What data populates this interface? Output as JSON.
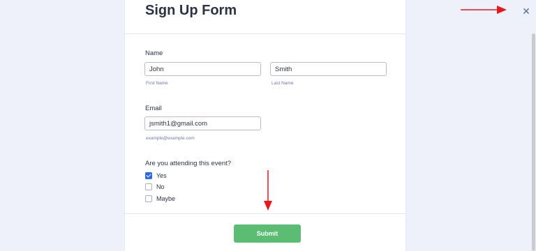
{
  "form": {
    "title": "Sign Up Form",
    "name": {
      "label": "Name",
      "first_value": "John",
      "first_sublabel": "First Name",
      "last_value": "Smith",
      "last_sublabel": "Last Name"
    },
    "email": {
      "label": "Email",
      "value": "jsmith1@gmail.com",
      "sublabel": "example@example.com"
    },
    "attending": {
      "question": "Are you attending this event?",
      "options": [
        {
          "label": "Yes",
          "checked": true
        },
        {
          "label": "No",
          "checked": false
        },
        {
          "label": "Maybe",
          "checked": false
        }
      ]
    },
    "submit_label": "Submit"
  },
  "close_icon": "close-icon",
  "annotation_color": "#e8171c",
  "colors": {
    "accent": "#2e69e4",
    "submit": "#5bbd72",
    "background": "#eef0fa"
  }
}
